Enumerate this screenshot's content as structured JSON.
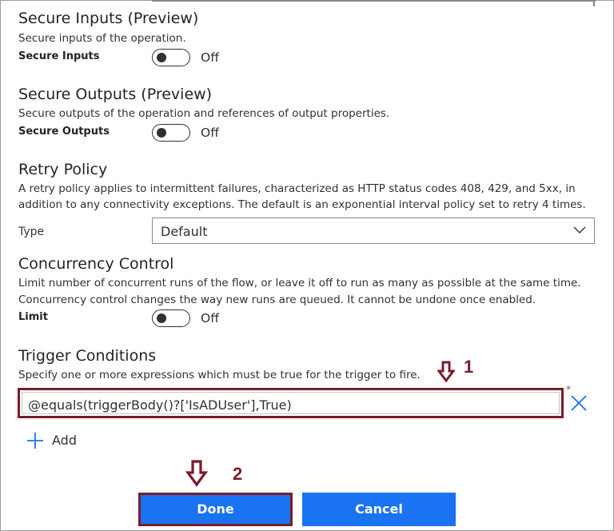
{
  "secure_inputs": {
    "title": "Secure Inputs (Preview)",
    "description": "Secure inputs of the operation.",
    "label": "Secure Inputs",
    "state": "Off"
  },
  "secure_outputs": {
    "title": "Secure Outputs (Preview)",
    "description": "Secure outputs of the operation and references of output properties.",
    "label": "Secure Outputs",
    "state": "Off"
  },
  "retry_policy": {
    "title": "Retry Policy",
    "description_line1": "A retry policy applies to intermittent failures, characterized as HTTP status codes 408, 429, and 5xx, in",
    "description_line2": "addition to any connectivity exceptions. The default is an exponential interval policy set to retry 4 times.",
    "type_label": "Type",
    "type_value": "Default"
  },
  "concurrency": {
    "title": "Concurrency Control",
    "description_line1": "Limit number of concurrent runs of the flow, or leave it off to run as many as possible at the same time.",
    "description_line2": "Concurrency control changes the way new runs are queued. It cannot be undone once enabled.",
    "label": "Limit",
    "state": "Off"
  },
  "trigger_conditions": {
    "title": "Trigger Conditions",
    "description": "Specify one or more expressions which must be true for the trigger to fire.",
    "expression": "@equals(triggerBody()?['IsADUser'],True)",
    "required_mark": "*",
    "add_label": "Add"
  },
  "annotations": {
    "marker1": "1",
    "marker2": "2",
    "color": "#7b1c2c"
  },
  "buttons": {
    "done": "Done",
    "cancel": "Cancel",
    "primary_color": "#1a73f0"
  },
  "icons": {
    "chevron": "chevron-down-icon",
    "remove": "close-icon",
    "add": "plus-icon",
    "arrow": "arrow-down-icon"
  }
}
